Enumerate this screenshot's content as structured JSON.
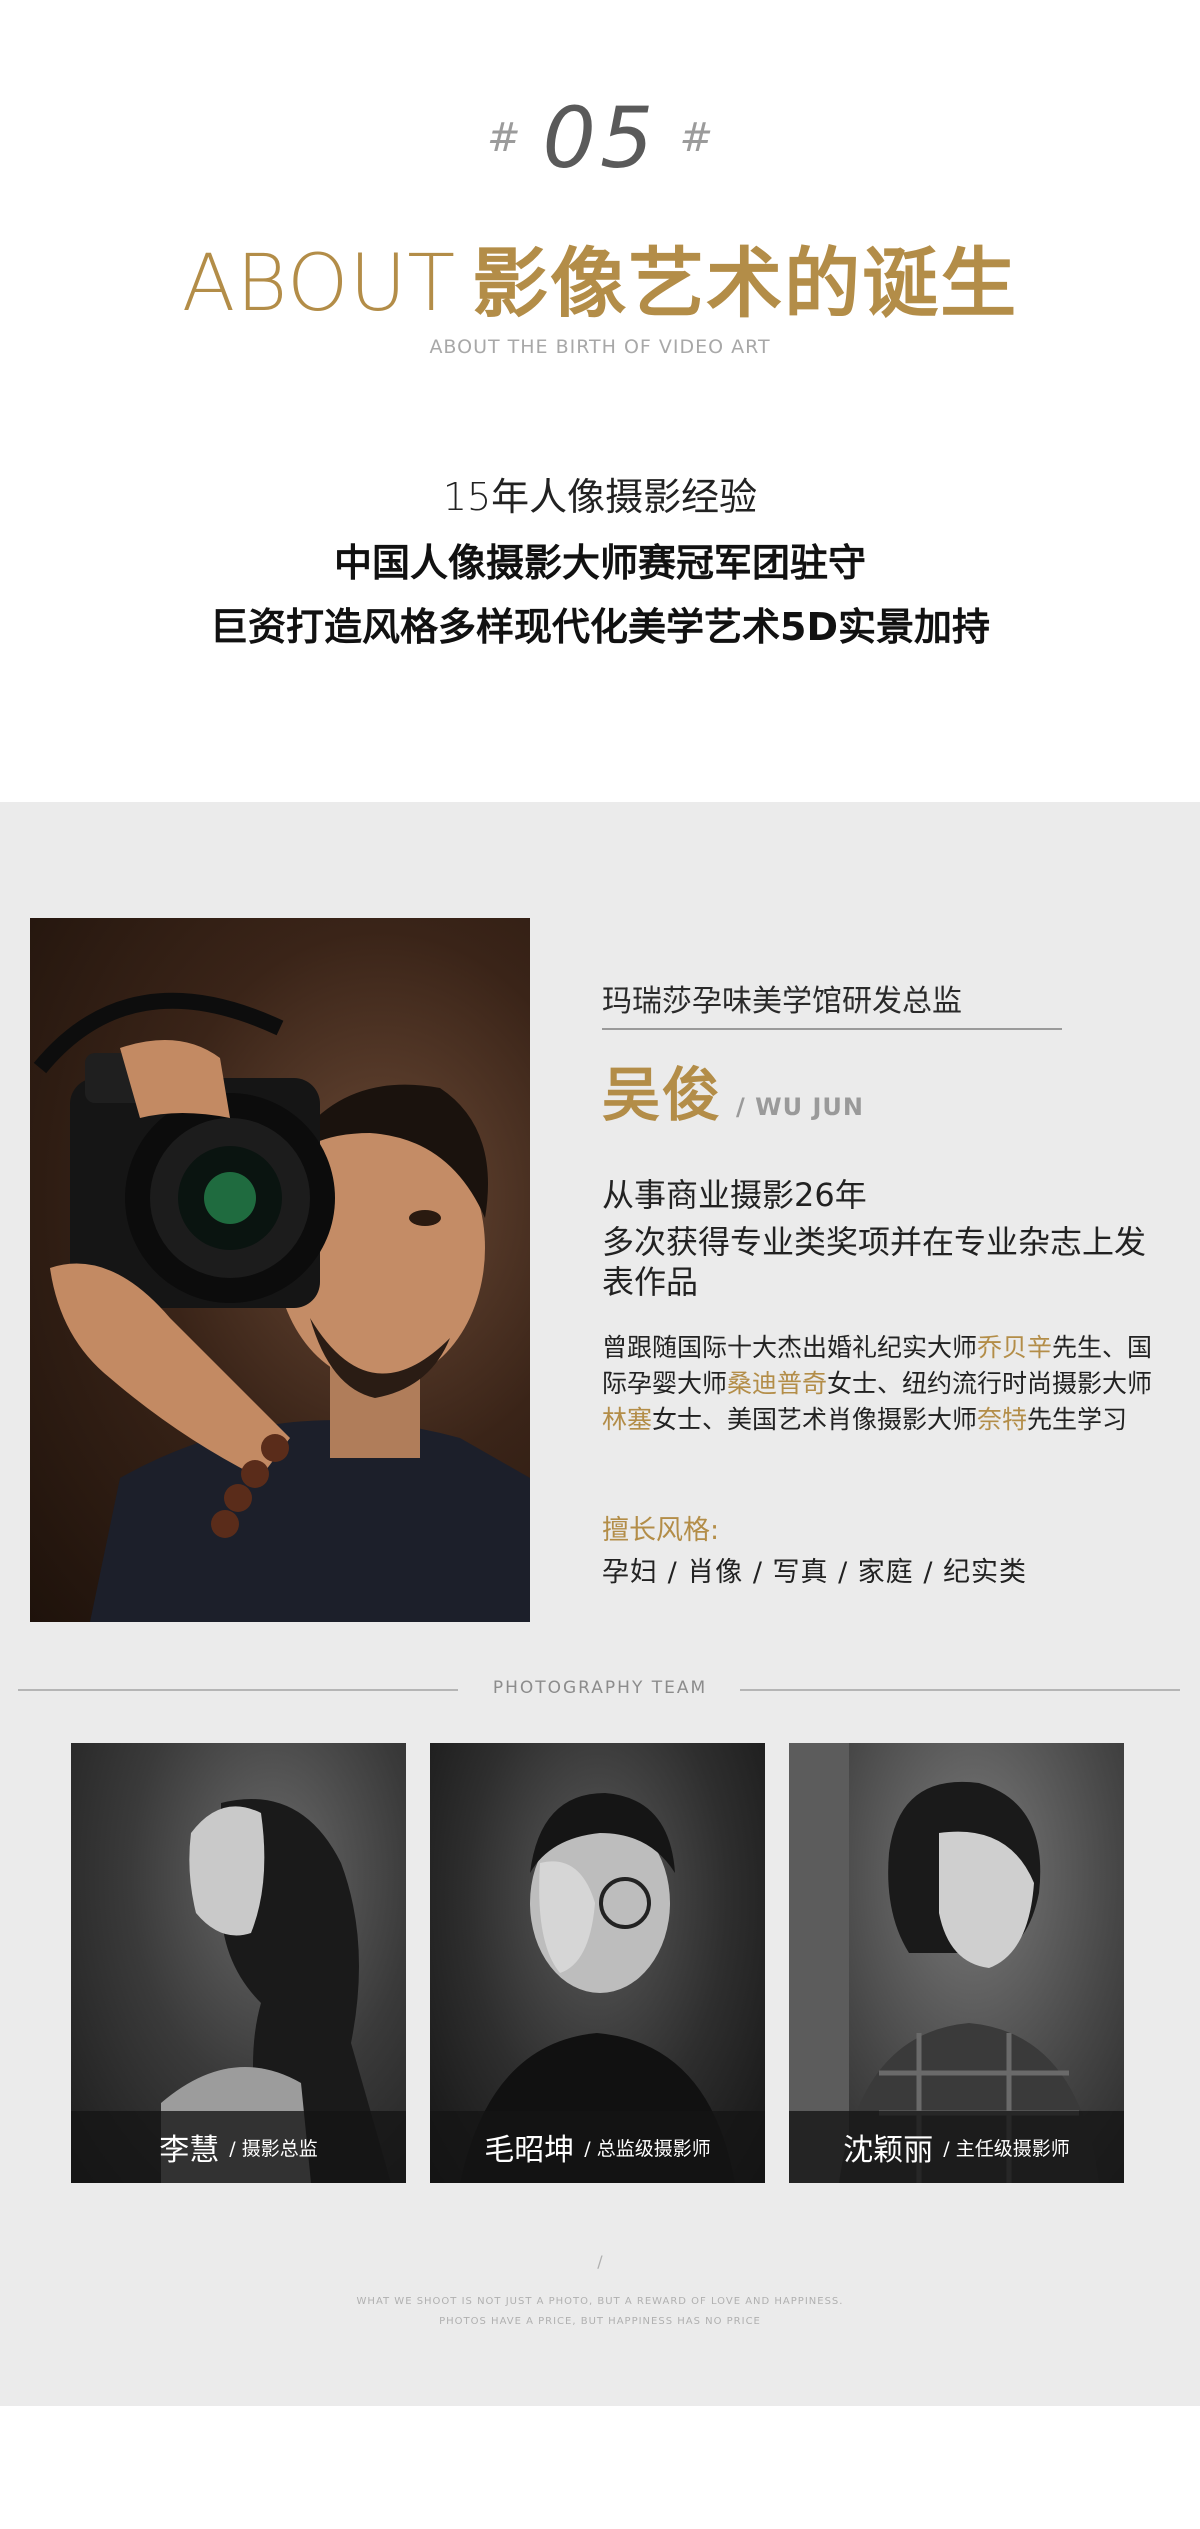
{
  "header": {
    "hash_left": "#",
    "number": "05",
    "hash_right": "#",
    "title_en": "ABOUT",
    "title_cn": "影像艺术的诞生",
    "subtitle": "ABOUT THE BIRTH OF VIDEO ART"
  },
  "intro": {
    "line1": "15年人像摄影经验",
    "line2": "中国人像摄影大师赛冠军团驻守",
    "line3": "巨资打造风格多样现代化美学艺术5D实景加持"
  },
  "lead": {
    "role": "玛瑞莎孕味美学馆研发总监",
    "name_cn": "吴俊",
    "name_en": "/ WU JUN",
    "exp1": "从事商业摄影26年",
    "exp2": "多次获得专业类奖项并在专业杂志上发表作品",
    "bio": {
      "p1": "曾跟随国际十大杰出婚礼纪实大师",
      "g1": "乔贝辛",
      "p2": "先生、国际孕婴大师",
      "g2": "桑迪普奇",
      "p3": "女士、纽约流行时尚摄影大师",
      "g3": "林塞",
      "p4": "女士、美国艺术肖像摄影大师",
      "g4": "奈特",
      "p5": "先生学习"
    },
    "style_label": "擅长风格:",
    "style_value": "孕妇 / 肖像 / 写真 / 家庭 / 纪实类"
  },
  "team": {
    "title": "PHOTOGRAPHY TEAM",
    "members": [
      {
        "name": "李慧",
        "role": "/ 摄影总监"
      },
      {
        "name": "毛昭坤",
        "role": "/ 总监级摄影师"
      },
      {
        "name": "沈颖丽",
        "role": "/ 主任级摄影师"
      }
    ]
  },
  "footer": {
    "slash": "/",
    "tagline1": "WHAT WE SHOOT IS NOT JUST A PHOTO, BUT A REWARD OF LOVE AND HAPPINESS.",
    "tagline2": "PHOTOS HAVE A PRICE, BUT HAPPINESS HAS NO PRICE"
  },
  "colors": {
    "accent_gold": "#b38d48",
    "grey_bg": "#ebebeb"
  }
}
